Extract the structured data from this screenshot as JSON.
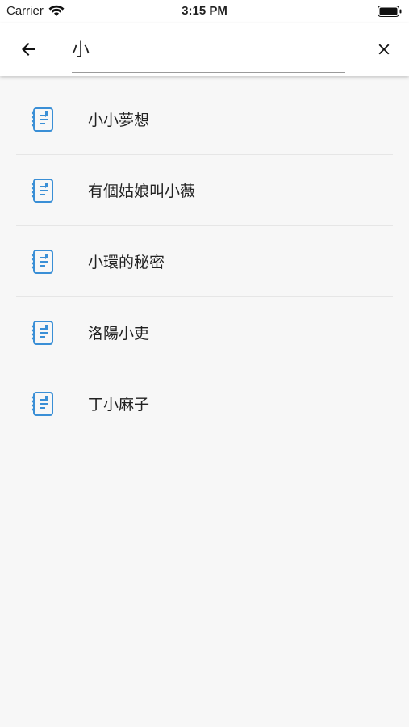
{
  "status_bar": {
    "carrier": "Carrier",
    "time": "3:15 PM"
  },
  "search": {
    "query": "小"
  },
  "icons": {
    "back": "arrow-left-icon",
    "clear": "close-icon",
    "item": "notebook-icon"
  },
  "colors": {
    "accent": "#3a8fd6"
  },
  "results": [
    {
      "title": "小小夢想"
    },
    {
      "title": "有個姑娘叫小薇"
    },
    {
      "title": "小環的秘密"
    },
    {
      "title": "洛陽小吏"
    },
    {
      "title": "丁小麻子"
    }
  ]
}
